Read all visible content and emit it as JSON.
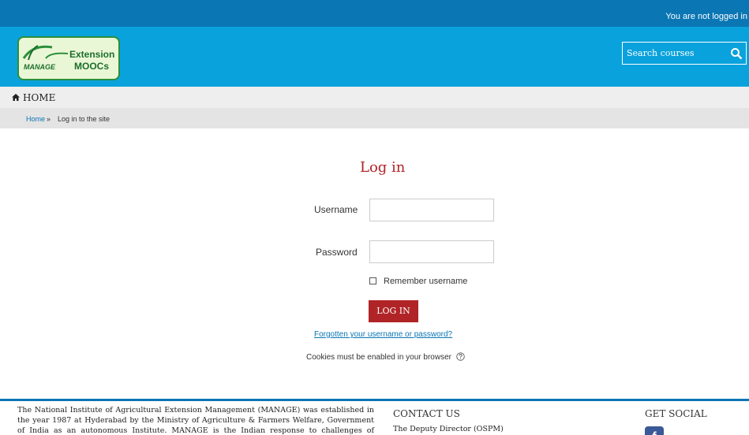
{
  "topbar": {
    "login_status": "You are not logged in"
  },
  "logo": {
    "line1": "Extension",
    "line2": "MOOCs",
    "wordmark": "MANAGE"
  },
  "search": {
    "placeholder": "Search courses",
    "icon": "search-icon"
  },
  "nav": {
    "home_label": "HOME",
    "icon": "home-icon"
  },
  "breadcrumb": {
    "home": "Home",
    "separator": "»",
    "current": "Log in to the site"
  },
  "login": {
    "title": "Log in",
    "username_label": "Username",
    "username_value": "",
    "password_label": "Password",
    "password_value": "",
    "remember_label": "Remember username",
    "remember_checked": false,
    "button_label": "LOG IN",
    "forgot_link": "Forgotten your username or password?",
    "cookies_notice": "Cookies must be enabled in your browser"
  },
  "footer": {
    "about_text": "The National Institute of Agricultural Extension Management (MANAGE) was established in the year 1987 at Hyderabad by the Ministry of Agriculture & Farmers Welfare, Government of India as an autonomous Institute. MANAGE is the Indian response to challenges of agricultural",
    "contact_heading": "CONTACT US",
    "contact_line": "The Deputy Director (OSPM)",
    "social_heading": "GET SOCIAL",
    "social_icon": "facebook-icon"
  },
  "colors": {
    "topbar": "#0a76b4",
    "header": "#09a2dc",
    "accent_red": "#b02427",
    "link": "#0a76b4"
  }
}
